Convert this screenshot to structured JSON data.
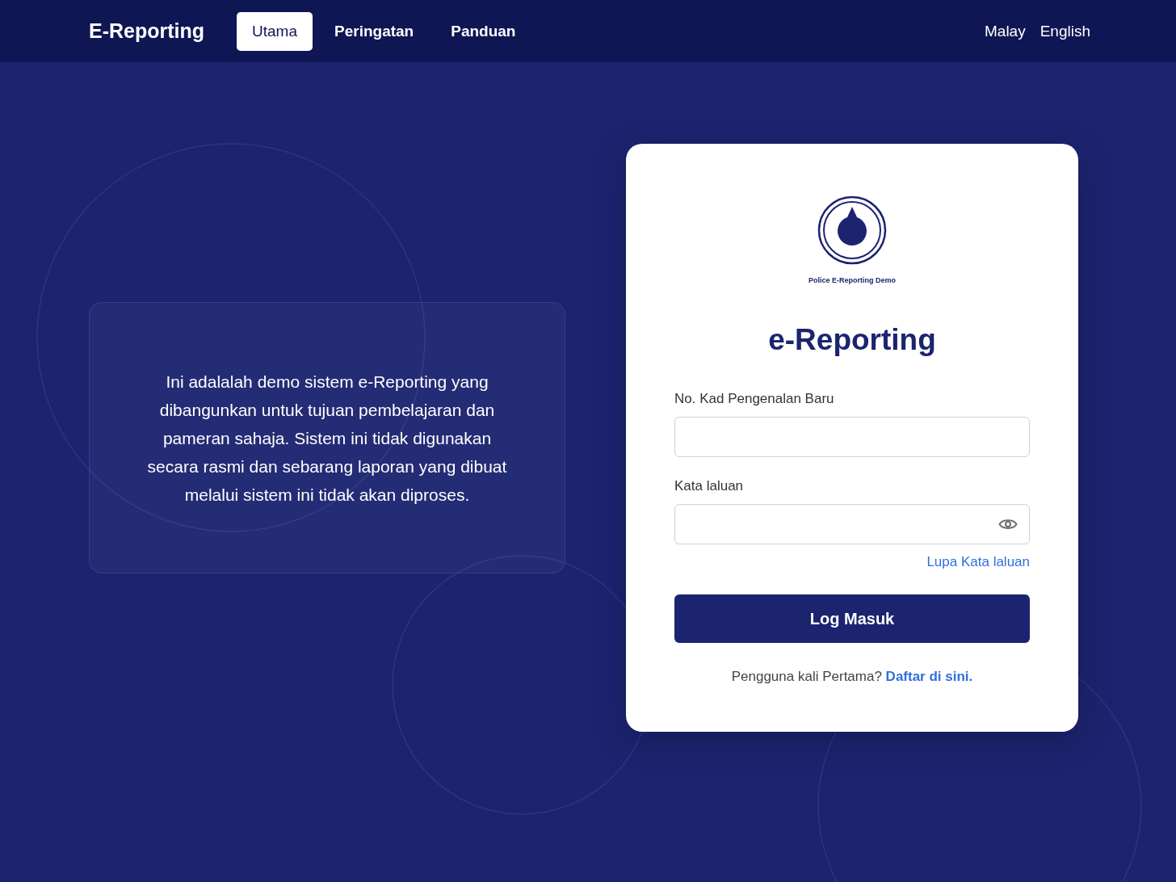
{
  "nav": {
    "brand": "E-Reporting",
    "tabs": [
      {
        "label": "Utama",
        "selected": true
      },
      {
        "label": "Peringatan",
        "selected": false
      },
      {
        "label": "Panduan",
        "selected": false
      }
    ],
    "languages": [
      "Malay",
      "English"
    ]
  },
  "info": {
    "text": "Ini adalalah demo sistem e-Reporting yang dibangunkan untuk tujuan pembelajaran dan pameran sahaja. Sistem ini tidak digunakan secara rasmi dan sebarang laporan yang dibuat melalui sistem ini tidak akan diproses."
  },
  "login": {
    "logo_caption": "Police E-Reporting Demo",
    "title": "e-Reporting",
    "fields": [
      {
        "label": "No. Kad Pengenalan Baru",
        "kind": "text"
      },
      {
        "label": "Kata laluan",
        "kind": "password"
      }
    ],
    "forgot_link": "Lupa Kata laluan",
    "submit": "Log Masuk",
    "register_prompt": "Pengguna kali Pertama?",
    "register_link": "Daftar di sini."
  }
}
